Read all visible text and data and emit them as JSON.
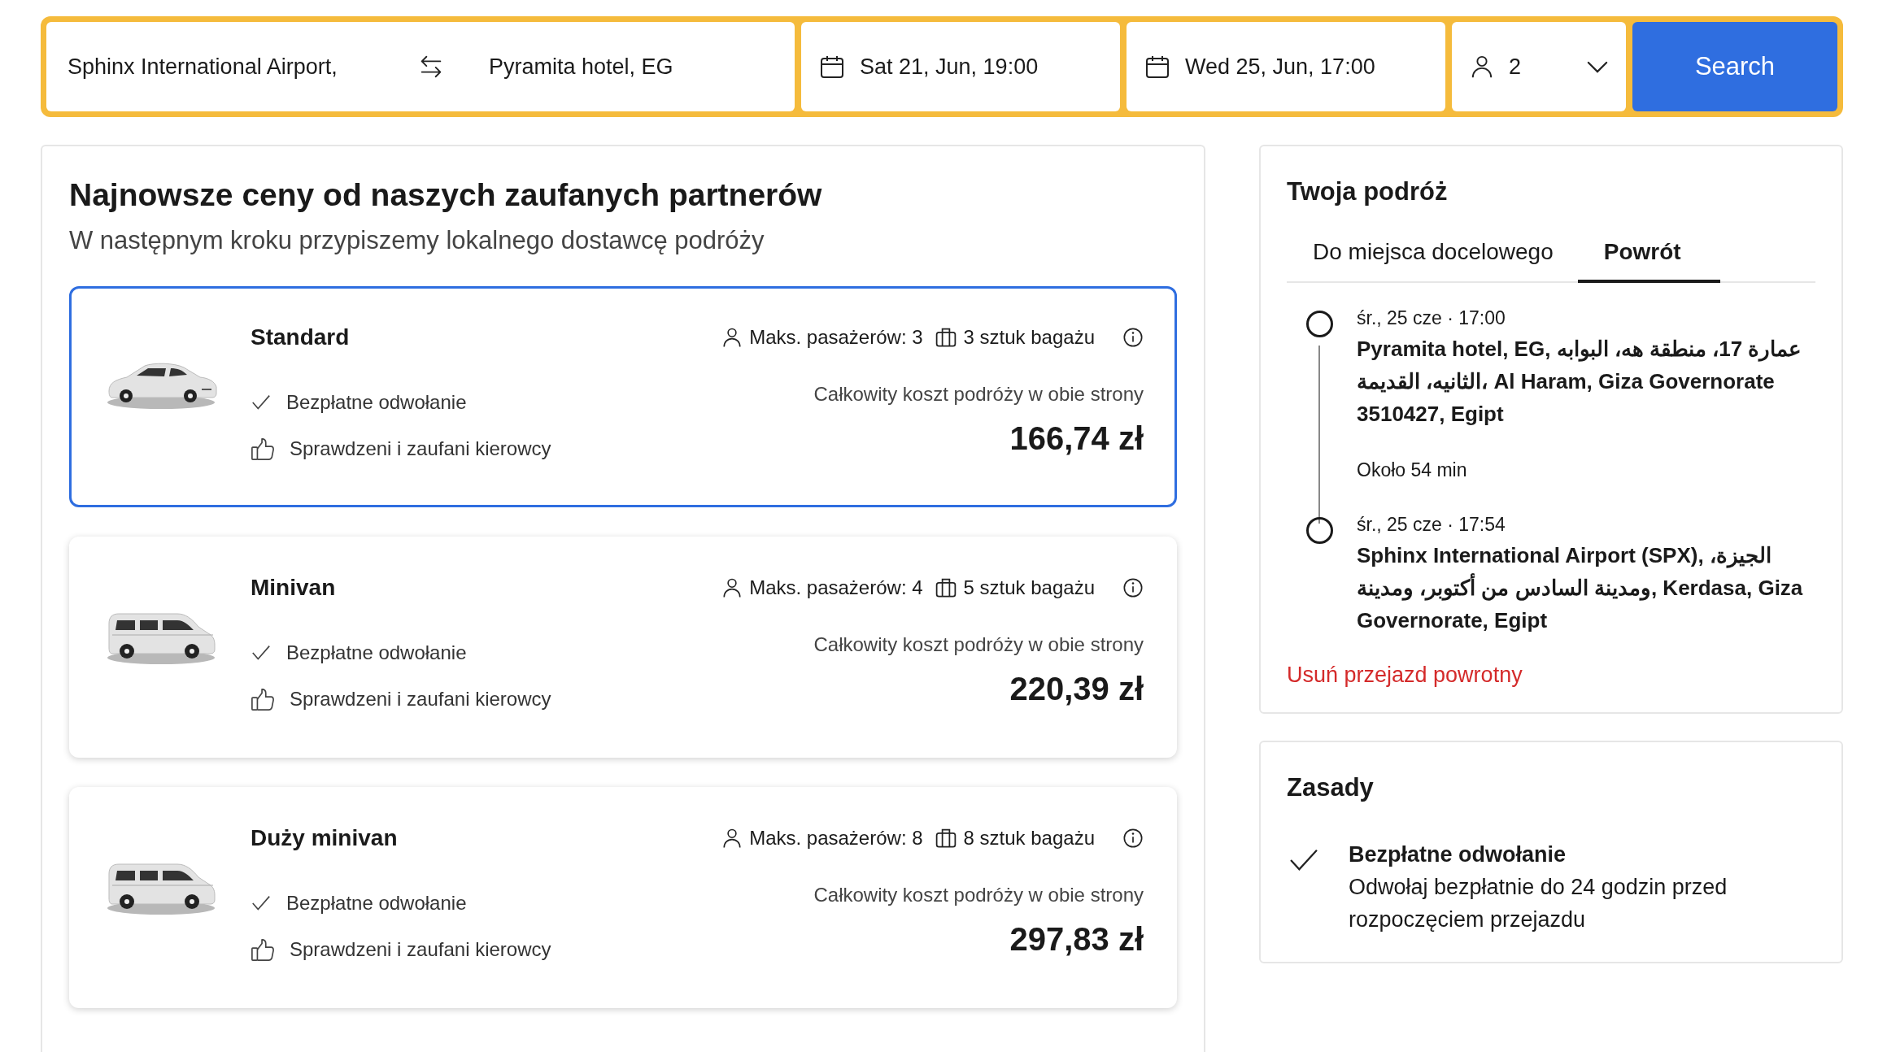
{
  "search": {
    "from": "Sphinx International Airport,",
    "to": "Pyramita hotel, EG",
    "depart": "Sat 21, Jun, 19:00",
    "return": "Wed 25, Jun, 17:00",
    "passengers": "2",
    "button": "Search"
  },
  "offers": {
    "heading": "Najnowsze ceny od naszych zaufanych partnerów",
    "subtitle": "W następnym kroku przypiszemy lokalnego dostawcę podróży",
    "cards": [
      {
        "name": "Standard",
        "kind": "sedan",
        "selected": true,
        "passengers": "Maks. pasażerów: 3",
        "luggage": "3 sztuk bagażu",
        "features": [
          {
            "kind": "check",
            "text": "Bezpłatne odwołanie"
          },
          {
            "kind": "thumb",
            "text": "Sprawdzeni i zaufani kierowcy"
          }
        ],
        "price_label": "Całkowity koszt podróży w obie strony",
        "price": "166,74 zł"
      },
      {
        "name": "Minivan",
        "kind": "van",
        "selected": false,
        "passengers": "Maks. pasażerów: 4",
        "luggage": "5 sztuk bagażu",
        "features": [
          {
            "kind": "check",
            "text": "Bezpłatne odwołanie"
          },
          {
            "kind": "thumb",
            "text": "Sprawdzeni i zaufani kierowcy"
          }
        ],
        "price_label": "Całkowity koszt podróży w obie strony",
        "price": "220,39 zł"
      },
      {
        "name": "Duży minivan",
        "kind": "van",
        "selected": false,
        "passengers": "Maks. pasażerów: 8",
        "luggage": "8 sztuk bagażu",
        "features": [
          {
            "kind": "check",
            "text": "Bezpłatne odwołanie"
          },
          {
            "kind": "thumb",
            "text": "Sprawdzeni i zaufani kierowcy"
          }
        ],
        "price_label": "Całkowity koszt podróży w obie strony",
        "price": "297,83 zł"
      }
    ]
  },
  "trip": {
    "title": "Twoja podróż",
    "tabs": [
      {
        "label": "Do miejsca docelowego",
        "selected": false
      },
      {
        "label": "Powrót",
        "selected": true
      }
    ],
    "stops": [
      {
        "time": "śr., 25 cze · 17:00",
        "address": "Pyramita hotel, EG, عمارة 17، منطقة هه، البوابه الثانيه، القديمة، Al Haram, Giza Governorate 3510427, Egipt"
      },
      {
        "time": "śr., 25 cze · 17:54",
        "address": "Sphinx International Airport (SPX), الجيزة، ومدينة السادس من أكتوبر، ومدينة, Kerdasa, Giza Governorate, Egipt"
      }
    ],
    "duration": "Około 54 min",
    "remove_link": "Usuń przejazd powrotny"
  },
  "rules": {
    "title": "Zasady",
    "items": [
      {
        "title": "Bezpłatne odwołanie",
        "text": "Odwołaj bezpłatnie do 24 godzin przed rozpoczęciem przejazdu"
      }
    ]
  }
}
